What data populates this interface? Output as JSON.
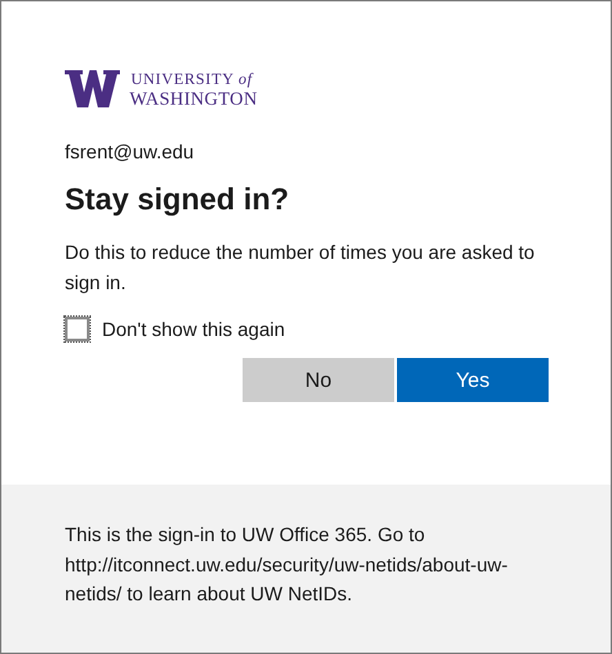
{
  "logo": {
    "line_1": "UNIVERSITY *of*",
    "line_2": "WASHINGTON"
  },
  "account": "fsrent@uw.edu",
  "title": "Stay signed in?",
  "description": "Do this to reduce the number of times you are asked to sign in.",
  "checkbox": {
    "label": "Don't show this again",
    "checked": false
  },
  "buttons": [
    {
      "label": "No",
      "kind": "secondary"
    },
    {
      "label": "Yes",
      "kind": "primary"
    }
  ],
  "footer": "This is the sign-in to UW Office 365. Go to http://itconnect.uw.edu/security/uw-netids/about-uw-netids/ to learn about UW NetIDs."
}
